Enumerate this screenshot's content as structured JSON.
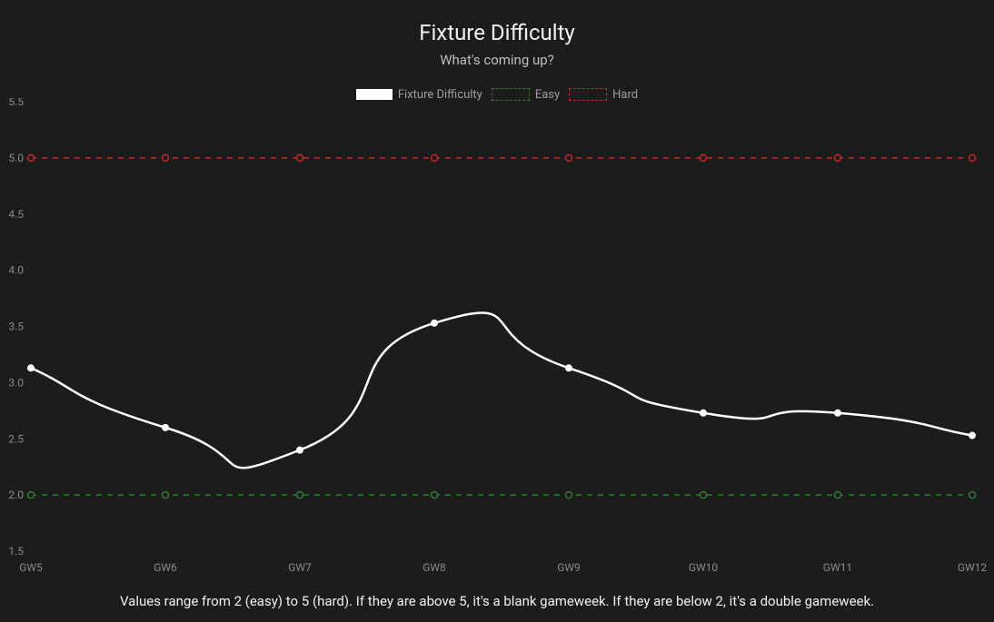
{
  "chart_data": {
    "type": "line",
    "title": "Fixture Difficulty",
    "subtitle": "What's coming up?",
    "xlabel": "",
    "ylabel": "",
    "ylim": [
      1.5,
      5.5
    ],
    "yticks": [
      1.5,
      2.0,
      2.5,
      3.0,
      3.5,
      4.0,
      4.5,
      5.0,
      5.5
    ],
    "categories": [
      "GW5",
      "GW6",
      "GW7",
      "GW8",
      "GW9",
      "GW10",
      "GW11",
      "GW12"
    ],
    "series": [
      {
        "name": "Fixture Difficulty",
        "color": "#ffffff",
        "style": "solid",
        "values": [
          3.13,
          2.6,
          2.4,
          3.53,
          3.13,
          2.73,
          2.73,
          2.53
        ]
      },
      {
        "name": "Easy",
        "color": "#2e7d32",
        "style": "dashed",
        "values": [
          2,
          2,
          2,
          2,
          2,
          2,
          2,
          2
        ]
      },
      {
        "name": "Hard",
        "color": "#c62828",
        "style": "dashed",
        "values": [
          5,
          5,
          5,
          5,
          5,
          5,
          5,
          5
        ]
      }
    ],
    "legend": {
      "items": [
        "Fixture Difficulty",
        "Easy",
        "Hard"
      ]
    },
    "caption": "Values range from 2 (easy) to 5 (hard). If they are above 5, it's a blank gameweek. If they are below 2, it's a double gameweek."
  }
}
